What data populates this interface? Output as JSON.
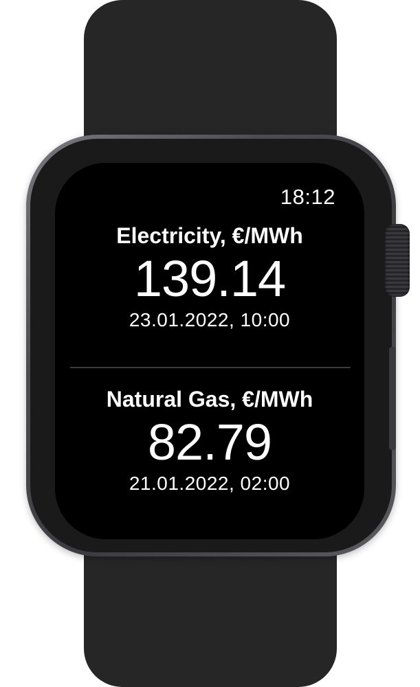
{
  "watch": {
    "time": "18:12"
  },
  "electricity": {
    "label": "Electricity, €/MWh",
    "value": "139.14",
    "timestamp": "23.01.2022, 10:00"
  },
  "natural_gas": {
    "label": "Natural Gas, €/MWh",
    "value": "82.79",
    "timestamp": "21.01.2022, 02:00"
  },
  "colors": {
    "band": "#262626",
    "screen": "#000000",
    "text": "#ffffff",
    "divider": "#3d3d40"
  }
}
